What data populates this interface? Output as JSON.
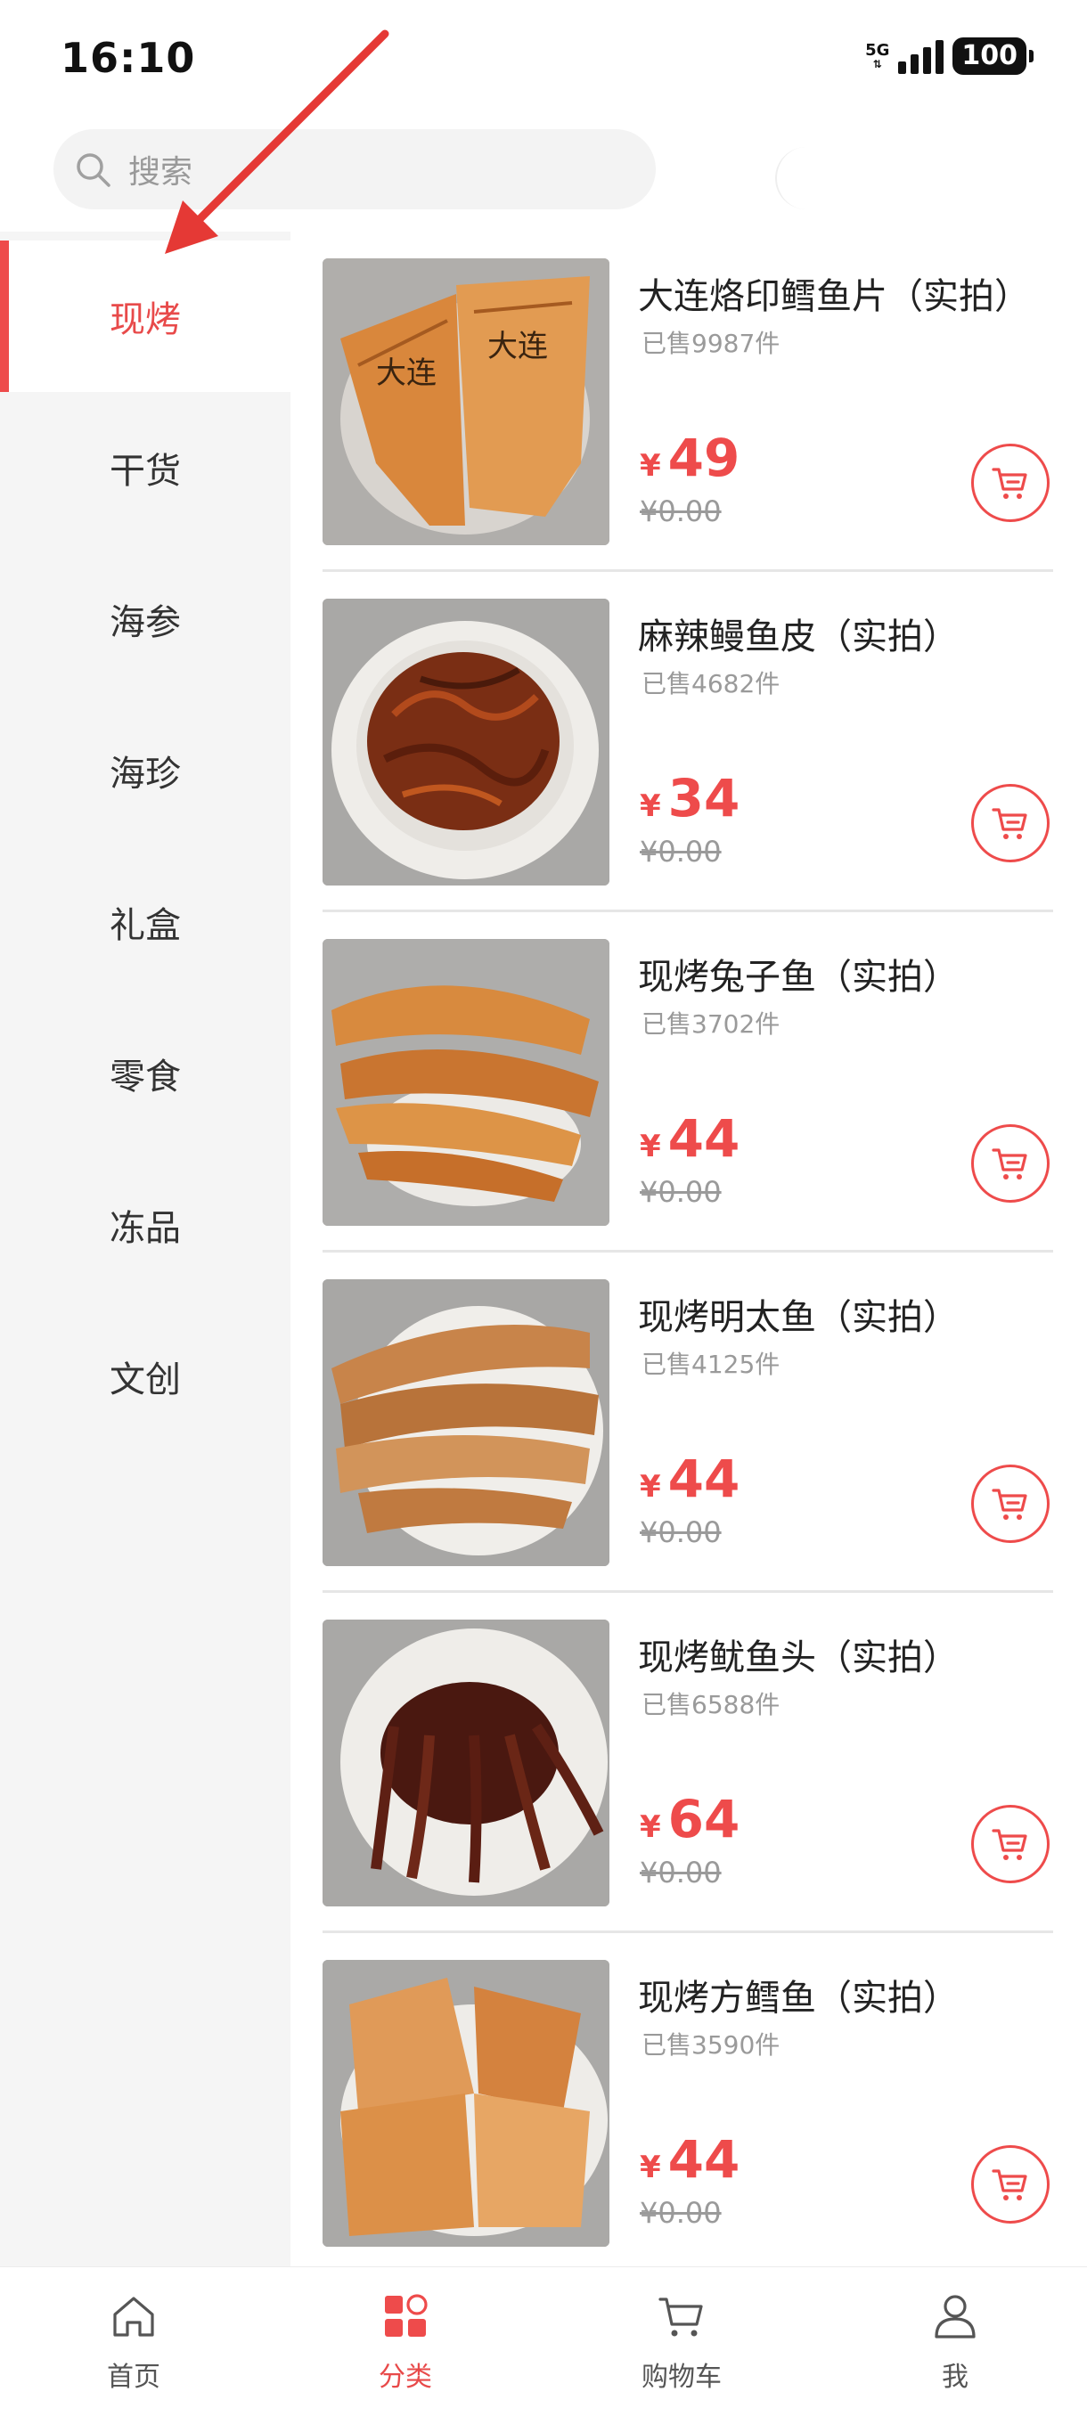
{
  "status": {
    "time": "16:10",
    "network": "5G",
    "battery": "100"
  },
  "search": {
    "placeholder": "搜索"
  },
  "categories": [
    {
      "label": "现烤",
      "active": true
    },
    {
      "label": "干货"
    },
    {
      "label": "海参"
    },
    {
      "label": "海珍"
    },
    {
      "label": "礼盒"
    },
    {
      "label": "零食"
    },
    {
      "label": "冻品"
    },
    {
      "label": "文创"
    }
  ],
  "products": [
    {
      "name": "大连烙印鳕鱼片（实拍）",
      "sold": "已售9987件",
      "currency": "¥",
      "price": "49",
      "original_price": "¥0.00"
    },
    {
      "name": "麻辣鳗鱼皮（实拍）",
      "sold": "已售4682件",
      "currency": "¥",
      "price": "34",
      "original_price": "¥0.00"
    },
    {
      "name": "现烤兔子鱼（实拍）",
      "sold": "已售3702件",
      "currency": "¥",
      "price": "44",
      "original_price": "¥0.00"
    },
    {
      "name": "现烤明太鱼（实拍）",
      "sold": "已售4125件",
      "currency": "¥",
      "price": "44",
      "original_price": "¥0.00"
    },
    {
      "name": "现烤鱿鱼头（实拍）",
      "sold": "已售6588件",
      "currency": "¥",
      "price": "64",
      "original_price": "¥0.00"
    },
    {
      "name": "现烤方鳕鱼（实拍）",
      "sold": "已售3590件",
      "currency": "¥",
      "price": "44",
      "original_price": "¥0.00"
    }
  ],
  "nav": [
    {
      "label": "首页",
      "icon": "home-icon"
    },
    {
      "label": "分类",
      "icon": "category-icon",
      "active": true
    },
    {
      "label": "购物车",
      "icon": "cart-icon"
    },
    {
      "label": "我",
      "icon": "user-icon"
    }
  ],
  "colors": {
    "accent": "#ee4b4b",
    "sidebar_bg": "#f5f5f5",
    "muted": "#9a9a9a"
  }
}
